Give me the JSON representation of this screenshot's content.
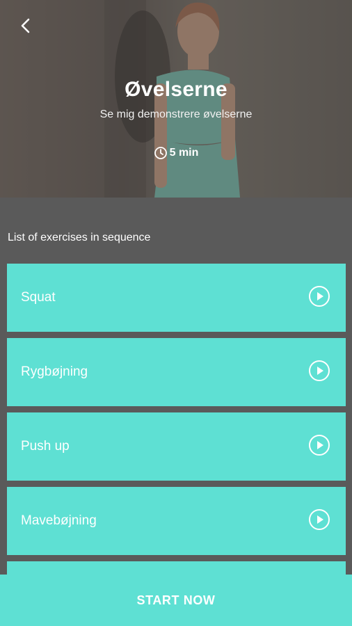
{
  "header": {
    "title": "Øvelserne",
    "subtitle": "Se mig demonstrere øvelserne",
    "duration": "5 min",
    "back_icon": "chevron-left-icon",
    "clock_icon": "clock-icon",
    "photo": "woman-in-mint-sportswear-photo"
  },
  "main": {
    "section_label": "List of exercises in sequence",
    "exercises": [
      {
        "label": "Squat",
        "icon": "play-circle-icon"
      },
      {
        "label": "Rygbøjning",
        "icon": "play-circle-icon"
      },
      {
        "label": "Push up",
        "icon": "play-circle-icon"
      },
      {
        "label": "Mavebøjning",
        "icon": "play-circle-icon"
      }
    ]
  },
  "footer": {
    "start_label": "START NOW"
  },
  "colors": {
    "accent": "#5ee0d3",
    "background": "#5a5a5a"
  }
}
